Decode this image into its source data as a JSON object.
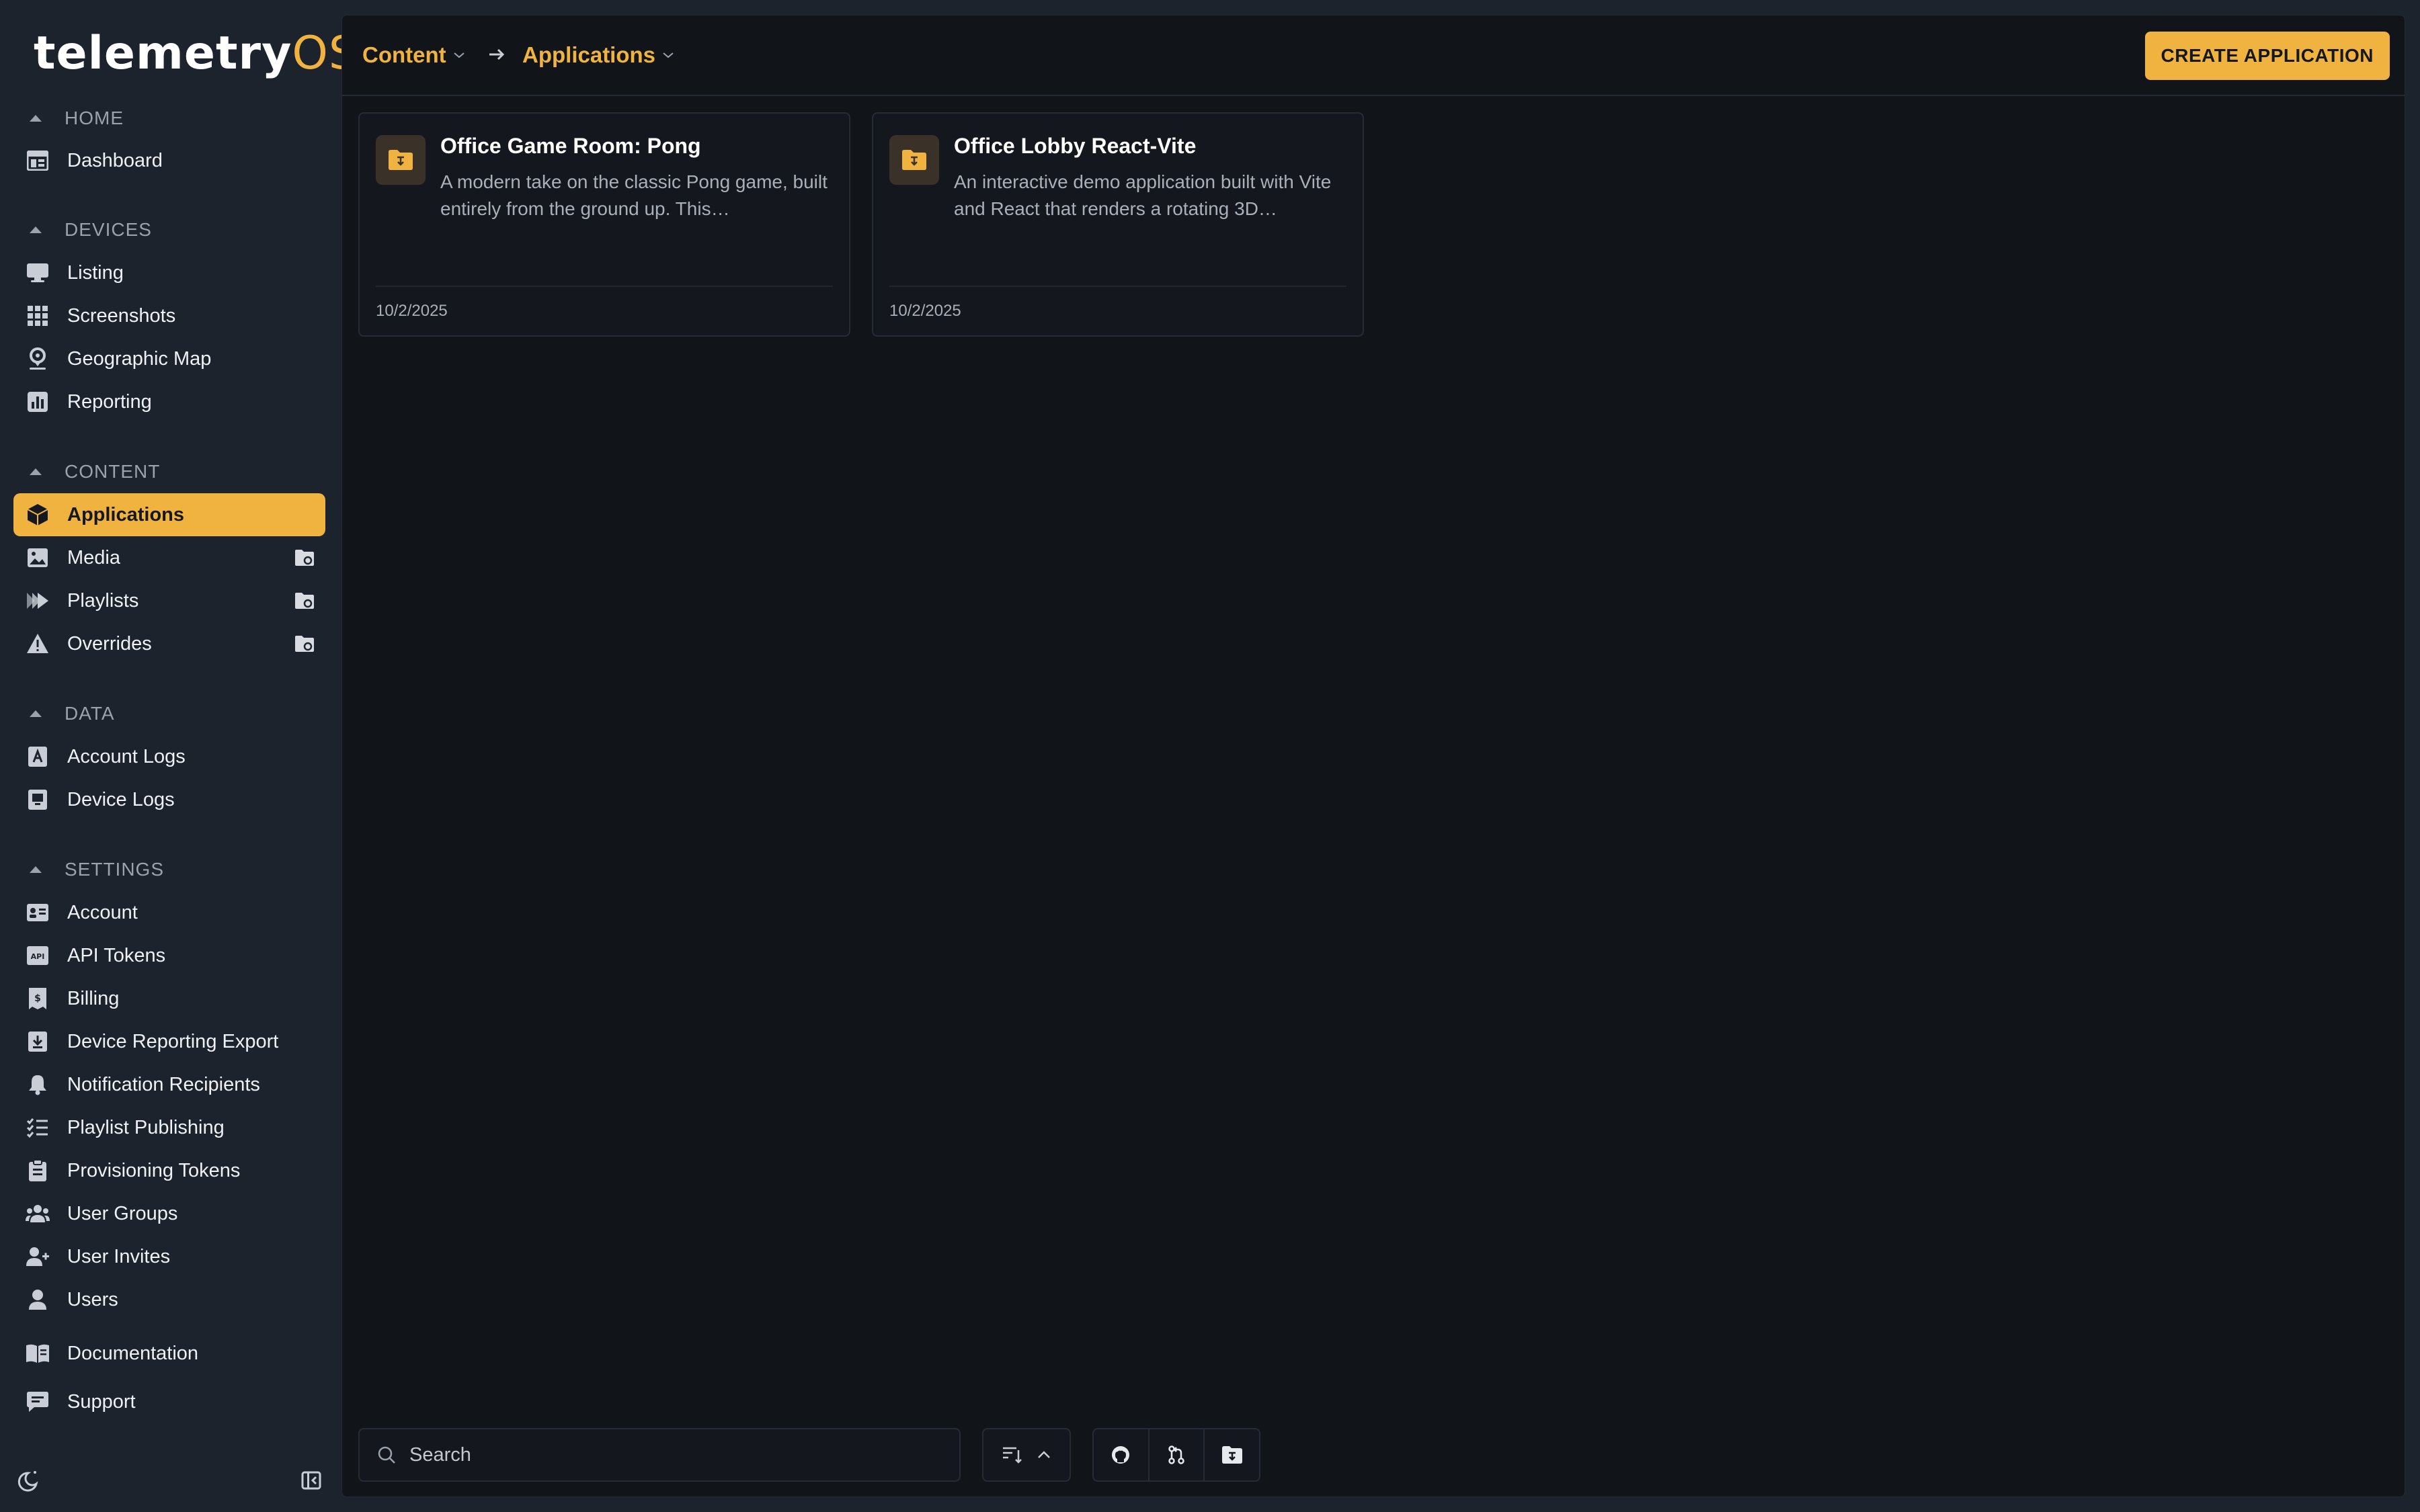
{
  "logo": {
    "brand": "telemetry",
    "suffix": "OS"
  },
  "sidebar": {
    "sections": [
      {
        "title": "HOME",
        "items": [
          {
            "label": "Dashboard",
            "icon": "dashboard-icon"
          }
        ]
      },
      {
        "title": "DEVICES",
        "items": [
          {
            "label": "Listing",
            "icon": "monitor-icon"
          },
          {
            "label": "Screenshots",
            "icon": "grid-icon"
          },
          {
            "label": "Geographic Map",
            "icon": "map-pin-icon"
          },
          {
            "label": "Reporting",
            "icon": "bar-chart-icon"
          }
        ]
      },
      {
        "title": "CONTENT",
        "items": [
          {
            "label": "Applications",
            "icon": "cube-icon",
            "active": true
          },
          {
            "label": "Media",
            "icon": "image-icon"
          },
          {
            "label": "Playlists",
            "icon": "playlist-icon"
          },
          {
            "label": "Overrides",
            "icon": "warning-icon"
          }
        ]
      },
      {
        "title": "DATA",
        "items": [
          {
            "label": "Account Logs",
            "icon": "account-log-icon"
          },
          {
            "label": "Device Logs",
            "icon": "device-log-icon"
          }
        ]
      },
      {
        "title": "SETTINGS",
        "items": [
          {
            "label": "Account",
            "icon": "id-card-icon"
          },
          {
            "label": "API Tokens",
            "icon": "api-icon"
          },
          {
            "label": "Billing",
            "icon": "receipt-icon"
          },
          {
            "label": "Device Reporting Export",
            "icon": "download-icon"
          },
          {
            "label": "Notification Recipients",
            "icon": "bell-icon"
          },
          {
            "label": "Playlist Publishing",
            "icon": "checklist-icon"
          },
          {
            "label": "Provisioning Tokens",
            "icon": "clipboard-icon"
          },
          {
            "label": "User Groups",
            "icon": "users-icon"
          },
          {
            "label": "User Invites",
            "icon": "user-plus-icon"
          },
          {
            "label": "Users",
            "icon": "user-icon"
          }
        ]
      }
    ],
    "footer_items": [
      {
        "label": "Documentation",
        "icon": "book-icon"
      },
      {
        "label": "Support",
        "icon": "chat-icon"
      }
    ]
  },
  "topbar": {
    "breadcrumb": [
      "Content",
      "Applications"
    ],
    "create_button": "CREATE APPLICATION"
  },
  "cards": [
    {
      "title": "Office Game Room: Pong",
      "description": "A modern take on the classic Pong game, built entirely from the ground up. This…",
      "date": "10/2/2025"
    },
    {
      "title": "Office Lobby React-Vite",
      "description": "An interactive demo application built with Vite and React that renders a rotating 3D…",
      "date": "10/2/2025"
    }
  ],
  "search": {
    "placeholder": "Search"
  },
  "colors": {
    "accent": "#f1b33f",
    "sidebar_bg": "#1d232d",
    "main_bg": "#111419"
  }
}
